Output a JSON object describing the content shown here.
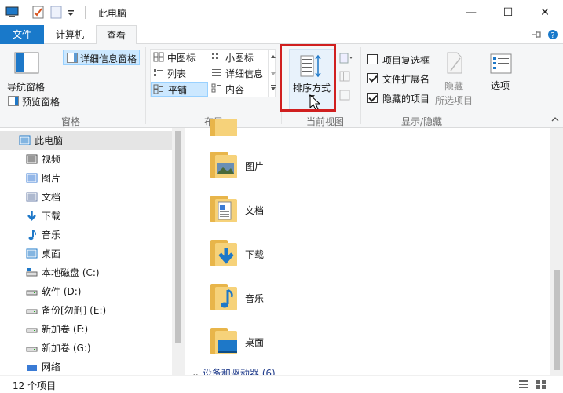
{
  "window": {
    "title": "此电脑",
    "minimize_glyph": "—",
    "maximize_glyph": "☐",
    "close_glyph": "✕"
  },
  "tabs": [
    {
      "label": "文件"
    },
    {
      "label": "计算机"
    },
    {
      "label": "查看"
    }
  ],
  "ribbon": {
    "pane": {
      "nav_pane": "导航窗格",
      "preview_pane": "预览窗格",
      "details_pane": "详细信息窗格",
      "group_label": "窗格"
    },
    "layout": {
      "items": [
        "中图标",
        "小图标",
        "列表",
        "详细信息",
        "平铺",
        "内容"
      ],
      "selected": "平铺",
      "group_label": "布局"
    },
    "current_view": {
      "sort_by": "排序方式",
      "group_label": "当前视图"
    },
    "show_hide": {
      "item_checkboxes": "项目复选框",
      "file_extensions": "文件扩展名",
      "hidden_items": "隐藏的项目",
      "hide_selected_line1": "隐藏",
      "hide_selected_line2": "所选项目",
      "group_label": "显示/隐藏",
      "item_checkboxes_checked": false,
      "file_extensions_checked": true,
      "hidden_items_checked": true
    },
    "options": {
      "label": "选项"
    }
  },
  "nav": {
    "items": [
      {
        "label": "此电脑",
        "icon": "computer-icon"
      },
      {
        "label": "视频",
        "icon": "video-icon"
      },
      {
        "label": "图片",
        "icon": "pictures-icon"
      },
      {
        "label": "文档",
        "icon": "documents-icon"
      },
      {
        "label": "下载",
        "icon": "download-icon"
      },
      {
        "label": "音乐",
        "icon": "music-icon"
      },
      {
        "label": "桌面",
        "icon": "desktop-icon"
      },
      {
        "label": "本地磁盘 (C:)",
        "icon": "system-drive-icon"
      },
      {
        "label": "软件 (D:)",
        "icon": "drive-icon"
      },
      {
        "label": "备份[勿删] (E:)",
        "icon": "drive-icon"
      },
      {
        "label": "新加卷 (F:)",
        "icon": "drive-icon"
      },
      {
        "label": "新加卷 (G:)",
        "icon": "drive-icon"
      },
      {
        "label": "网络",
        "icon": "network-icon"
      }
    ]
  },
  "content": {
    "folders": [
      {
        "label": "图片"
      },
      {
        "label": "文档"
      },
      {
        "label": "下载"
      },
      {
        "label": "音乐"
      },
      {
        "label": "桌面"
      }
    ],
    "section_header": "设备和驱动器 (6)"
  },
  "status": {
    "item_count": "12 个项目"
  },
  "colors": {
    "accent": "#1979ca",
    "highlight_box": "#d01f1f",
    "folder": "#f6d27a"
  }
}
